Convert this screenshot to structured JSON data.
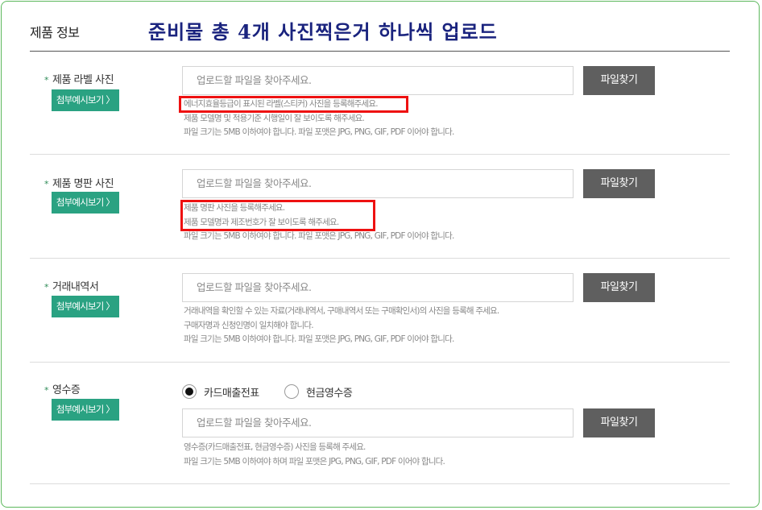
{
  "section": {
    "title": "제품 정보",
    "annotation": "준비물 총 4개 사진찍은거 하나씩 업로드"
  },
  "fields": [
    {
      "label": "제품 라벨 사진",
      "star": "*",
      "example_button": "첨부예시보기 〉",
      "placeholder": "업로드할 파일을 찾아주세요.",
      "find_button": "파일찾기",
      "help": [
        "에너지효율등급이 표시된 라벨(스티커) 사진을 등록해주세요.",
        "제품 모델명 및 적용기준 시행일이 잘 보이도록 해주세요.",
        "파일 크기는 5MB 이하여야 합니다. 파일 포맷은 JPG, PNG, GIF, PDF 이어야 합니다."
      ]
    },
    {
      "label": "제품 명판 사진",
      "star": "*",
      "example_button": "첨부예시보기 〉",
      "placeholder": "업로드할 파일을 찾아주세요.",
      "find_button": "파일찾기",
      "help": [
        "제품 명판 사진을 등록해주세요.",
        "제품 모델명과 제조번호가 잘 보이도록 해주세요.",
        "파일 크기는 5MB 이하여야 합니다. 파일 포맷은 JPG, PNG, GIF, PDF 이어야 합니다."
      ]
    },
    {
      "label": "거래내역서",
      "star": "*",
      "example_button": "첨부예시보기 〉",
      "placeholder": "업로드할 파일을 찾아주세요.",
      "find_button": "파일찾기",
      "help": [
        "거래내역을 확인할 수 있는 자료(거래내역서, 구매내역서 또는 구매확인서)의 사진을 등록해 주세요.",
        "구매자명과 신청인명이 일치해야 합니다.",
        "파일 크기는 5MB 이하여야 합니다. 파일 포맷은 JPG, PNG, GIF, PDF 이어야 합니다."
      ]
    },
    {
      "label": "영수증",
      "star": "*",
      "example_button": "첨부예시보기 〉",
      "placeholder": "업로드할 파일을 찾아주세요.",
      "find_button": "파일찾기",
      "radio_options": [
        {
          "label": "카드매출전표",
          "checked": true
        },
        {
          "label": "현금영수증",
          "checked": false
        }
      ],
      "help": [
        "영수증(카드매출전표, 현금영수증) 사진을 등록해 주세요.",
        "파일 크기는 5MB 이하여야 하며 파일 포맷은 JPG, PNG, GIF, PDF 이어야 합니다."
      ]
    }
  ],
  "colors": {
    "frame_border": "#5cb85c",
    "example_button": "#2aa282",
    "find_button": "#5f5f5f",
    "annotation_text": "#1a237e",
    "highlight_box": "#ee1111"
  }
}
